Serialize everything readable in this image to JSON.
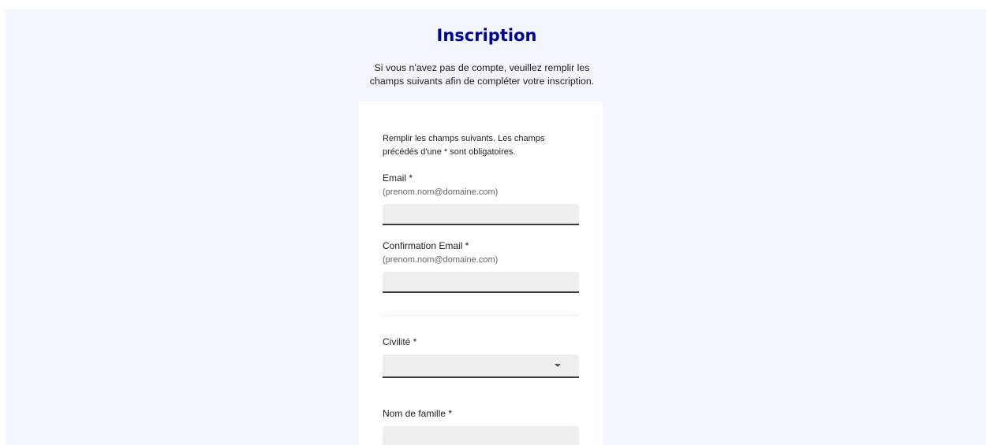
{
  "header": {
    "title": "Inscription",
    "intro_line1": "Si vous n'avez pas de compte, veuillez remplir les",
    "intro_line2": "champs suivants afin de compléter votre inscription."
  },
  "form": {
    "help_line1": "Remplir les champs suivants. Les champs",
    "help_line2": "précédés d'une * sont obligatoires.",
    "email": {
      "label": "Email *",
      "hint": "(prenom.nom@domaine.com)",
      "value": ""
    },
    "email_confirm": {
      "label": "Confirmation Email *",
      "hint": "(prenom.nom@domaine.com)",
      "value": ""
    },
    "civilite": {
      "label": "Civilité *",
      "selected": ""
    },
    "nom": {
      "label": "Nom de famille *",
      "value": ""
    }
  },
  "icons": {
    "dropdown": "chevron-down-icon"
  },
  "colors": {
    "title": "#000091",
    "background": "#f4f6fe",
    "input_bg": "#eeeeee",
    "input_border": "#3a3a3a"
  }
}
